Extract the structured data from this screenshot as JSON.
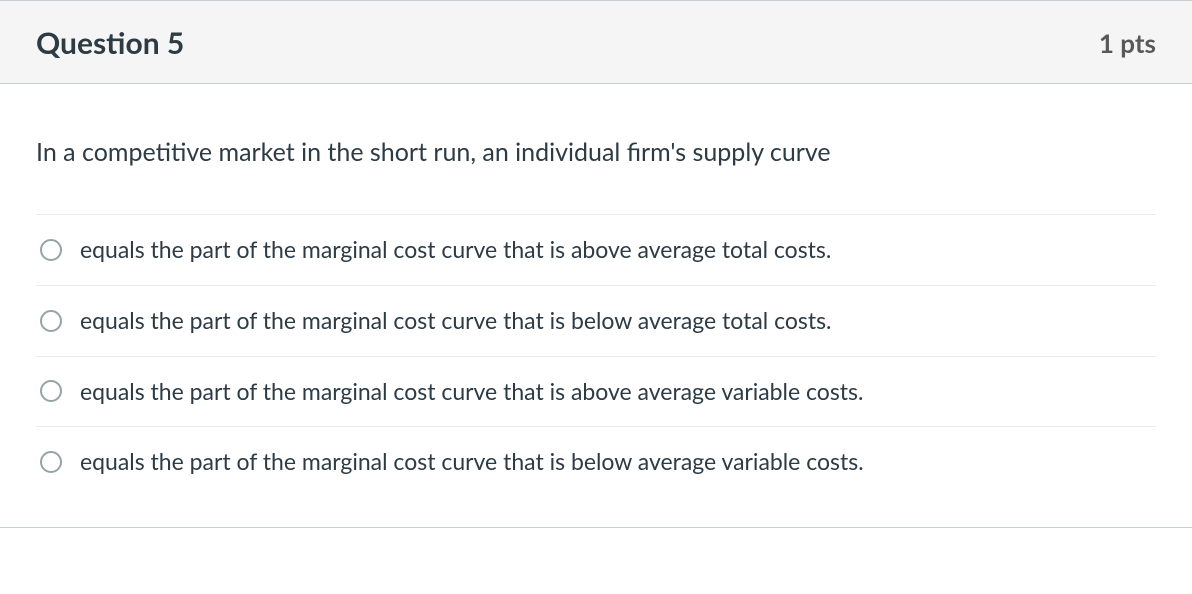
{
  "header": {
    "title": "Question 5",
    "points": "1 pts"
  },
  "question": {
    "prompt": "In a competitive market in the short run, an individual firm's supply curve",
    "answers": [
      "equals the part of the marginal cost curve that is above average total costs.",
      "equals the part of the marginal cost curve that is below average total costs.",
      "equals the part of the marginal cost curve that is above average variable costs.",
      "equals the part of the marginal cost curve that is below average variable costs."
    ]
  }
}
